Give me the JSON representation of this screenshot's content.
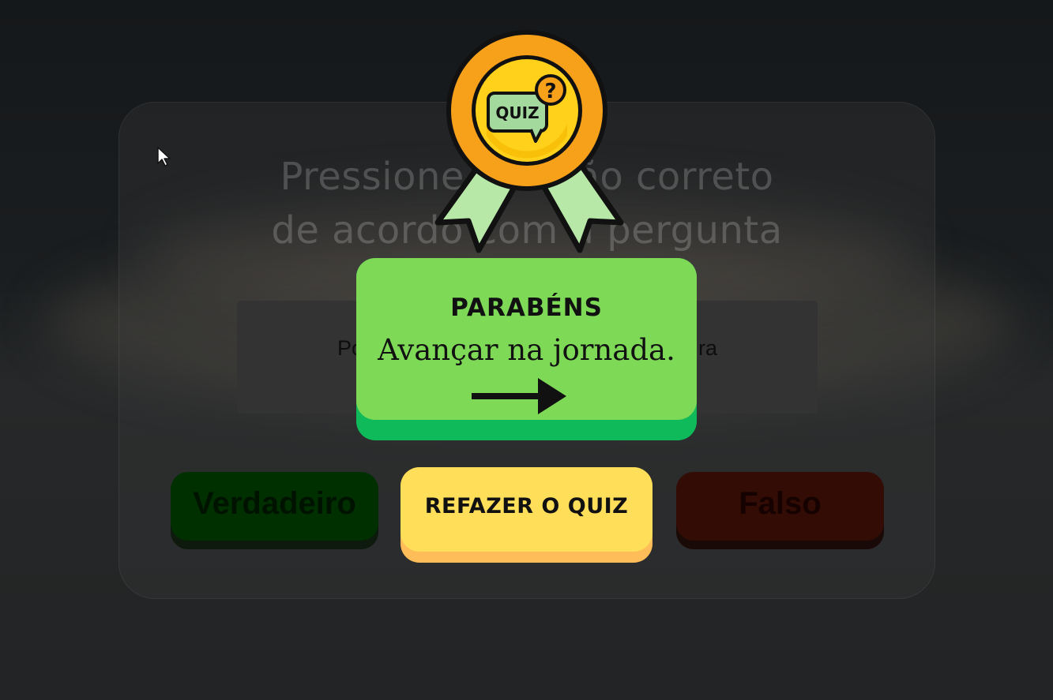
{
  "quiz": {
    "instruction_line1": "Pressione o botão correto",
    "instruction_line2": "de acordo com a pergunta",
    "question_left": "Po",
    "question_right": "ra",
    "true_label": "Verdadeiro",
    "false_label": "Falso"
  },
  "modal": {
    "badge_text": "QUIZ",
    "badge_symbol": "?",
    "title": "PARABÉNS",
    "subtitle": "Avançar na jornada.",
    "retry_label": "REFAZER O QUIZ",
    "arrow_icon": "arrow-right-icon",
    "badge_icon": "quiz-medal-icon"
  },
  "colors": {
    "advance_green": "#7ed957",
    "advance_green_dark": "#0fba5a",
    "retry_yellow": "#ffde59",
    "retry_yellow_dark": "#ffbd59",
    "medal_orange": "#f7a11a",
    "medal_gold": "#ffd11a",
    "ribbon_green": "#b8e8a8"
  }
}
